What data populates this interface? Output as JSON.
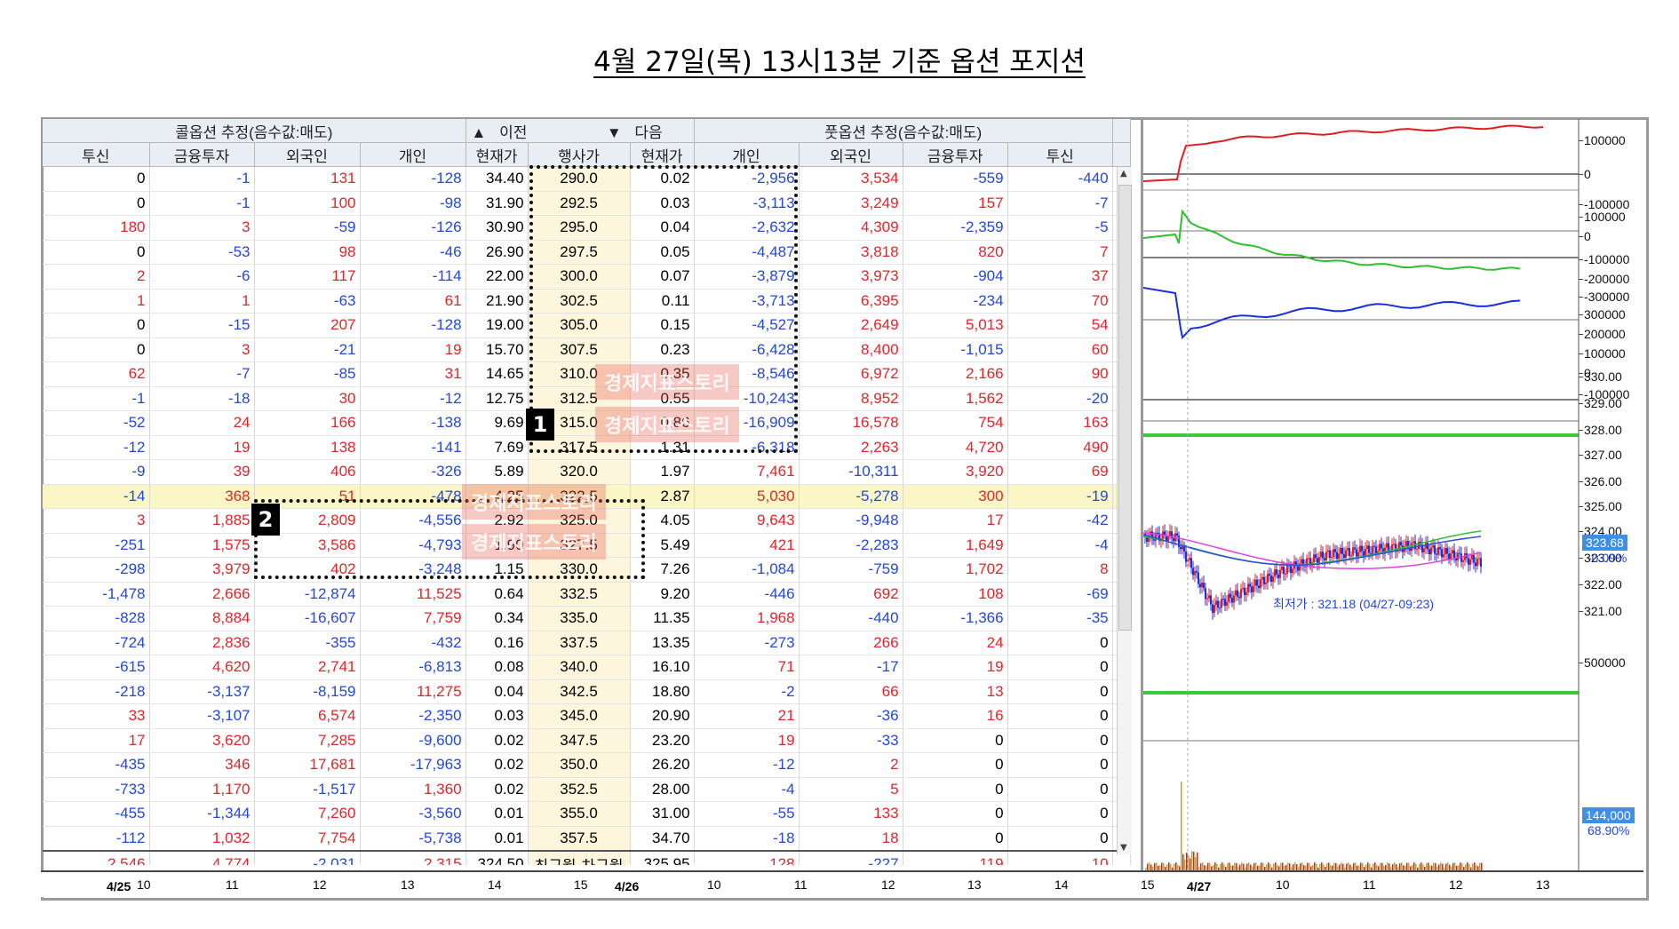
{
  "title": "4월 27일(목) 13시13분 기준 옵션 포지션",
  "header": {
    "call_group": "콜옵션 추정(음수값:매도)",
    "put_group": "풋옵션 추정(음수값:매도)",
    "prev_label": "이전",
    "next_label": "다음",
    "call_cols": [
      "투신",
      "금융투자",
      "외국인",
      "개인",
      "현재가"
    ],
    "strike_col": "행사가",
    "put_cols": [
      "현재가",
      "개인",
      "외국인",
      "금융투자",
      "투신"
    ]
  },
  "rows": [
    [
      "0",
      "-1",
      "131",
      "-128",
      "34.40",
      "290.0",
      "0.02",
      "-2,956",
      "3,534",
      "-559",
      "-440"
    ],
    [
      "0",
      "-1",
      "100",
      "-98",
      "31.90",
      "292.5",
      "0.03",
      "-3,113",
      "3,249",
      "157",
      "-7"
    ],
    [
      "180",
      "3",
      "-59",
      "-126",
      "30.90",
      "295.0",
      "0.04",
      "-2,632",
      "4,309",
      "-2,359",
      "-5"
    ],
    [
      "0",
      "-53",
      "98",
      "-46",
      "26.90",
      "297.5",
      "0.05",
      "-4,487",
      "3,818",
      "820",
      "7"
    ],
    [
      "2",
      "-6",
      "117",
      "-114",
      "22.00",
      "300.0",
      "0.07",
      "-3,879",
      "3,973",
      "-904",
      "37"
    ],
    [
      "1",
      "1",
      "-63",
      "61",
      "21.90",
      "302.5",
      "0.11",
      "-3,713",
      "6,395",
      "-234",
      "70"
    ],
    [
      "0",
      "-15",
      "207",
      "-128",
      "19.00",
      "305.0",
      "0.15",
      "-4,527",
      "2,649",
      "5,013",
      "54"
    ],
    [
      "0",
      "3",
      "-21",
      "19",
      "15.70",
      "307.5",
      "0.23",
      "-6,428",
      "8,400",
      "-1,015",
      "60"
    ],
    [
      "62",
      "-7",
      "-85",
      "31",
      "14.65",
      "310.0",
      "0.35",
      "-8,546",
      "6,972",
      "2,166",
      "90"
    ],
    [
      "-1",
      "-18",
      "30",
      "-12",
      "12.75",
      "312.5",
      "0.55",
      "-10,243",
      "8,952",
      "1,562",
      "-20"
    ],
    [
      "-52",
      "24",
      "166",
      "-138",
      "9.69",
      "315.0",
      "0.86",
      "-16,909",
      "16,578",
      "754",
      "163"
    ],
    [
      "-12",
      "19",
      "138",
      "-141",
      "7.69",
      "317.5",
      "1.31",
      "-6,318",
      "2,263",
      "4,720",
      "490"
    ],
    [
      "-9",
      "39",
      "406",
      "-326",
      "5.89",
      "320.0",
      "1.97",
      "7,461",
      "-10,311",
      "3,920",
      "69"
    ],
    [
      "-14",
      "368",
      "51",
      "-478",
      "4.25",
      "322.5",
      "2.87",
      "5,030",
      "-5,278",
      "300",
      "-19"
    ],
    [
      "3",
      "1,885",
      "2,809",
      "-4,556",
      "2.92",
      "325.0",
      "4.05",
      "9,643",
      "-9,948",
      "17",
      "-42"
    ],
    [
      "-251",
      "1,575",
      "3,586",
      "-4,793",
      "1.90",
      "327.5",
      "5.49",
      "421",
      "-2,283",
      "1,649",
      "-4"
    ],
    [
      "-298",
      "3,979",
      "402",
      "-3,248",
      "1.15",
      "330.0",
      "7.26",
      "-1,084",
      "-759",
      "1,702",
      "8"
    ],
    [
      "-1,478",
      "2,666",
      "-12,874",
      "11,525",
      "0.64",
      "332.5",
      "9.20",
      "-446",
      "692",
      "108",
      "-69"
    ],
    [
      "-828",
      "8,884",
      "-16,607",
      "7,759",
      "0.34",
      "335.0",
      "11.35",
      "1,968",
      "-440",
      "-1,366",
      "-35"
    ],
    [
      "-724",
      "2,836",
      "-355",
      "-432",
      "0.16",
      "337.5",
      "13.35",
      "-273",
      "266",
      "24",
      "0"
    ],
    [
      "-615",
      "4,620",
      "2,741",
      "-6,813",
      "0.08",
      "340.0",
      "16.10",
      "71",
      "-17",
      "19",
      "0"
    ],
    [
      "-218",
      "-3,137",
      "-8,159",
      "11,275",
      "0.04",
      "342.5",
      "18.80",
      "-2",
      "66",
      "13",
      "0"
    ],
    [
      "33",
      "-3,107",
      "6,574",
      "-2,350",
      "0.03",
      "345.0",
      "20.90",
      "21",
      "-36",
      "16",
      "0"
    ],
    [
      "17",
      "3,620",
      "7,285",
      "-9,600",
      "0.02",
      "347.5",
      "23.20",
      "19",
      "-33",
      "0",
      "0"
    ],
    [
      "-435",
      "346",
      "17,681",
      "-17,963",
      "0.02",
      "350.0",
      "26.20",
      "-12",
      "2",
      "0",
      "0"
    ],
    [
      "-733",
      "1,170",
      "-1,517",
      "1,360",
      "0.02",
      "352.5",
      "28.00",
      "-4",
      "5",
      "0",
      "0"
    ],
    [
      "-455",
      "-1,344",
      "7,260",
      "-3,560",
      "0.01",
      "355.0",
      "31.00",
      "-55",
      "133",
      "0",
      "0"
    ],
    [
      "-112",
      "1,032",
      "7,754",
      "-5,738",
      "0.01",
      "357.5",
      "34.70",
      "-18",
      "18",
      "0",
      "0"
    ]
  ],
  "highlight_strike": "322.5",
  "summary": [
    "2,546",
    "4,774",
    "-2,031",
    "2,315",
    "324.50",
    "최근월",
    "차근월",
    "325.95",
    "128",
    "-227",
    "119",
    "10"
  ],
  "annotations": {
    "box1": "1",
    "box2": "2",
    "watermark": "경제지표스토리"
  },
  "table_axis": {
    "date1": "4/25",
    "ticks1": [
      "10",
      "11",
      "12",
      "13",
      "14",
      "15"
    ],
    "date2": "4/26",
    "ticks2": [
      "10",
      "11",
      "12",
      "13",
      "14",
      "15"
    ]
  },
  "chart": {
    "pane1_labels": [
      "100000",
      "0",
      "-100000"
    ],
    "pane2_labels": [
      "100000",
      "0",
      "-100000",
      "-200000",
      "-300000"
    ],
    "pane3_labels": [
      "300000",
      "200000",
      "100000",
      "0",
      "-100000"
    ],
    "price_labels": [
      "330.00",
      "329.00",
      "328.00",
      "327.00",
      "326.00",
      "325.00",
      "324.00",
      "323.00",
      "322.00",
      "321.00"
    ],
    "current_price": "323.68",
    "change_pct": "-0.09%",
    "low_annotation": "최저가 : 321.18 (04/27-09:23)",
    "volume_labels": [
      "500000"
    ],
    "volume_current": "144,000",
    "volume_pct": "68.90%",
    "axis_date": "4/27",
    "axis_ticks": [
      "10",
      "11",
      "12",
      "13"
    ],
    "colors": {
      "call_line": "#e02020",
      "put_line": "#2fbf2f",
      "net_line": "#1a2fe0",
      "up": "#e02020",
      "down": "#1a2fe0"
    }
  }
}
